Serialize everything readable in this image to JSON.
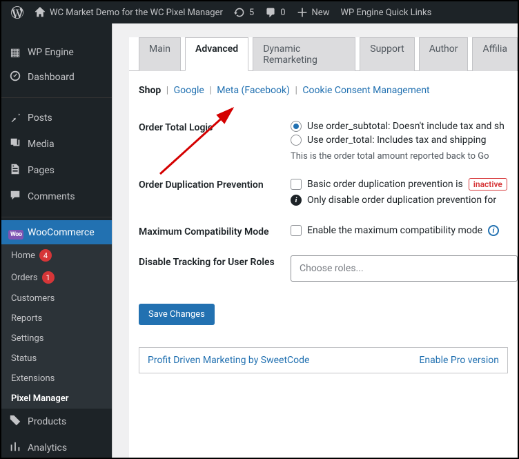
{
  "adminbar": {
    "site_title": "WC Market Demo for the WC Pixel Manager",
    "updates_count": "5",
    "comments_count": "0",
    "new_label": "New",
    "quicklinks_label": "WP Engine Quick Links"
  },
  "sidebar": {
    "items": [
      {
        "icon": "wpengine",
        "label": "WP Engine"
      },
      {
        "icon": "dashboard",
        "label": "Dashboard"
      }
    ],
    "items2": [
      {
        "icon": "pin",
        "label": "Posts"
      },
      {
        "icon": "media",
        "label": "Media"
      },
      {
        "icon": "pages",
        "label": "Pages"
      },
      {
        "icon": "comments",
        "label": "Comments"
      }
    ],
    "current": {
      "icon": "woo",
      "label": "WooCommerce"
    },
    "subitems": [
      {
        "label": "Home",
        "badge": "4"
      },
      {
        "label": "Orders",
        "badge": "1"
      },
      {
        "label": "Customers"
      },
      {
        "label": "Reports"
      },
      {
        "label": "Settings"
      },
      {
        "label": "Status"
      },
      {
        "label": "Extensions"
      },
      {
        "label": "Pixel Manager",
        "current": true
      }
    ],
    "items3": [
      {
        "icon": "products",
        "label": "Products"
      },
      {
        "icon": "analytics",
        "label": "Analytics"
      }
    ]
  },
  "tabs": [
    {
      "label": "Main"
    },
    {
      "label": "Advanced",
      "active": true
    },
    {
      "label": "Dynamic Remarketing"
    },
    {
      "label": "Support"
    },
    {
      "label": "Author"
    },
    {
      "label": "Affilia"
    }
  ],
  "sublinks": {
    "current": "Shop",
    "links": [
      "Google",
      "Meta (Facebook)",
      "Cookie Consent Management"
    ]
  },
  "form": {
    "order_total": {
      "label": "Order Total Logic",
      "opt1": "Use order_subtotal: Doesn't include tax and sh",
      "opt2": "Use order_total: Includes tax and shipping",
      "desc": "This is the order total amount reported back to Go"
    },
    "dupe": {
      "label": "Order Duplication Prevention",
      "check_label": "Basic order duplication prevention is",
      "status": "inactive",
      "note": "Only disable order duplication prevention for "
    },
    "compat": {
      "label": "Maximum Compatibility Mode",
      "check_label": "Enable the maximum compatibility mode"
    },
    "roles": {
      "label": "Disable Tracking for User Roles",
      "placeholder": "Choose roles..."
    },
    "save": "Save Changes"
  },
  "promo": {
    "left": "Profit Driven Marketing by SweetCode",
    "right": "Enable Pro version "
  }
}
